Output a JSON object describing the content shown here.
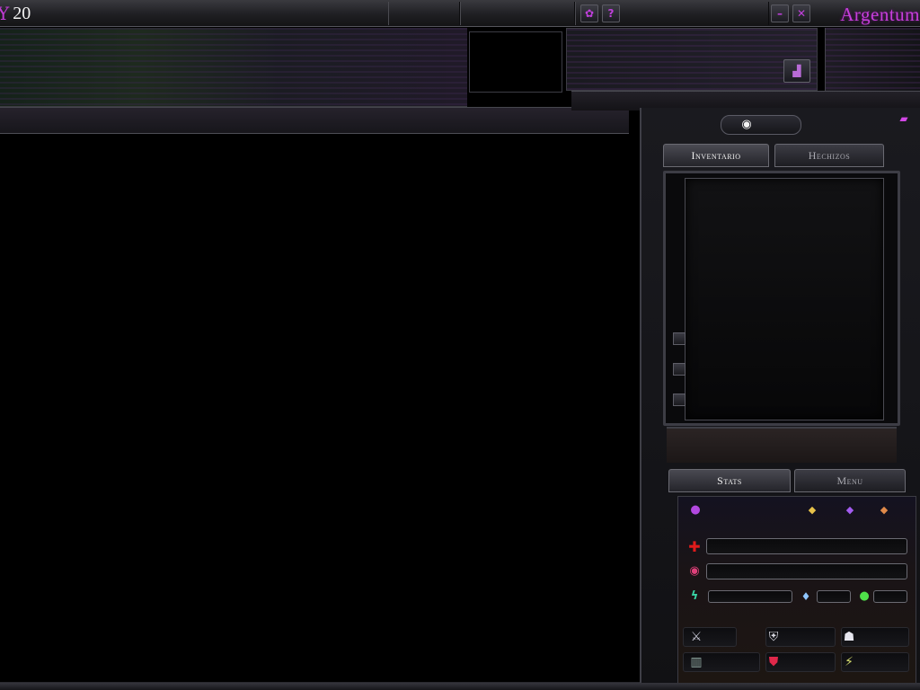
{
  "window": {
    "level_glyph": "Y",
    "level": "20",
    "brand": "Argentum",
    "buttons": {
      "settings_icon": "gear",
      "settings_glyph": "✿",
      "help_glyph": "?",
      "minimize_glyph": "–",
      "close_glyph": "✕"
    }
  },
  "top": {
    "stats_icon": "bar-chart",
    "stats_glyph": "▟",
    "chat_icon": "speech-bubble",
    "chat_glyph": "▰"
  },
  "panel": {
    "view_icon": "eye",
    "view_glyph": "◉",
    "tabs": [
      {
        "label": "Inventario",
        "active": true
      },
      {
        "label": "Hechizos",
        "active": false
      }
    ],
    "bottom_tabs": [
      {
        "label": "Stats",
        "active": true
      },
      {
        "label": "Menu",
        "active": false
      }
    ]
  },
  "stats": {
    "level_icon": "purple-orb",
    "gems": [
      "gold-gem",
      "violet-gem",
      "orange-gem"
    ],
    "health_icon": "red-cross",
    "mana_icon": "mana-swirl",
    "stamina_icon": "lightning",
    "water_icon": "water-bottle",
    "food_icon": "green-apple",
    "health_value": "",
    "mana_value": "",
    "stamina_value": "",
    "water_value": "",
    "food_value": ""
  },
  "equipment": [
    {
      "icon": "sword",
      "glyph": "⚔",
      "color": "#c9c9d6"
    },
    {
      "icon": "shield",
      "glyph": "⛨",
      "color": "#d8d8e0"
    },
    {
      "icon": "helmet",
      "glyph": "☗",
      "color": "#e6e6ee"
    },
    {
      "icon": "armor-chain",
      "glyph": "▥",
      "color": "#8fa7a0"
    },
    {
      "icon": "red-shield",
      "glyph": "⛊",
      "color": "#e0284a"
    },
    {
      "icon": "magic-spark",
      "glyph": "⚡",
      "color": "#d8e070"
    }
  ],
  "colors": {
    "accent": "#c73edc",
    "health": "#e01b1b",
    "mana": "#e0407a",
    "stamina": "#39d6a6"
  }
}
